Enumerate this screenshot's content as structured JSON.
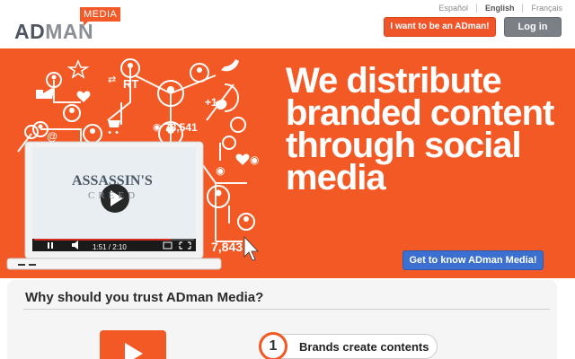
{
  "header": {
    "logo_ad": "AD",
    "logo_man": "MAN",
    "logo_media": "MEDIA",
    "languages": [
      "Español",
      "English",
      "Français"
    ],
    "active_language": "English",
    "cta_adman": "I want to be an ADman!",
    "login": "Log in"
  },
  "hero": {
    "headline": [
      "We distribute",
      "branded content",
      "through social",
      "media"
    ],
    "stats": {
      "views": "78,541",
      "count": "7,843",
      "plus": "+1",
      "retweet": "RT"
    },
    "video": {
      "title_line1": "ASSASSIN'S",
      "title_line2": "CREED",
      "time": "1:51 / 2:10",
      "progress": 0.85
    },
    "cta_know": "Get to know ADman Media!"
  },
  "trust": {
    "title": "Why should you trust ADman Media?",
    "step_number": "1",
    "step_text": "Brands create contents"
  },
  "colors": {
    "brand_orange": "#f25924",
    "cta_blue": "#3b6fd0",
    "login_grey": "#7b8086"
  }
}
